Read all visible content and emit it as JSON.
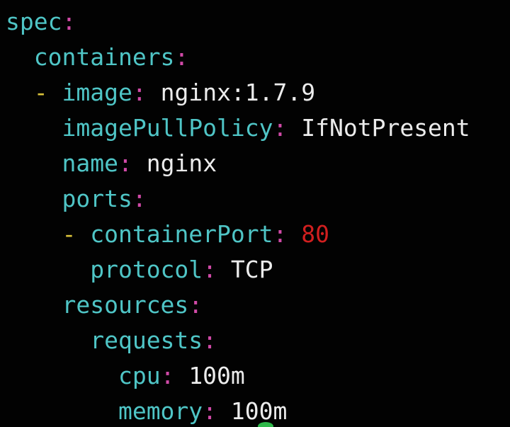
{
  "editor": {
    "lines": [
      {
        "indent": "",
        "dash": "",
        "key": "spec",
        "colon": ":",
        "value": "",
        "value_kind": "none"
      },
      {
        "indent": "  ",
        "dash": "",
        "key": "containers",
        "colon": ":",
        "value": "",
        "value_kind": "none"
      },
      {
        "indent": "  ",
        "dash": "- ",
        "key": "image",
        "colon": ":",
        "value": "nginx:1.7.9",
        "value_kind": "string"
      },
      {
        "indent": "    ",
        "dash": "",
        "key": "imagePullPolicy",
        "colon": ":",
        "value": "IfNotPresent",
        "value_kind": "string"
      },
      {
        "indent": "    ",
        "dash": "",
        "key": "name",
        "colon": ":",
        "value": "nginx",
        "value_kind": "string"
      },
      {
        "indent": "    ",
        "dash": "",
        "key": "ports",
        "colon": ":",
        "value": "",
        "value_kind": "none"
      },
      {
        "indent": "    ",
        "dash": "- ",
        "key": "containerPort",
        "colon": ":",
        "value": "80",
        "value_kind": "number"
      },
      {
        "indent": "      ",
        "dash": "",
        "key": "protocol",
        "colon": ":",
        "value": "TCP",
        "value_kind": "string"
      },
      {
        "indent": "    ",
        "dash": "",
        "key": "resources",
        "colon": ":",
        "value": "",
        "value_kind": "none"
      },
      {
        "indent": "      ",
        "dash": "",
        "key": "requests",
        "colon": ":",
        "value": "",
        "value_kind": "none"
      },
      {
        "indent": "        ",
        "dash": "",
        "key": "cpu",
        "colon": ":",
        "value": "100m",
        "value_kind": "string"
      },
      {
        "indent": "        ",
        "dash": "",
        "key": "memory",
        "colon": ":",
        "value": "100m",
        "value_kind": "string"
      }
    ]
  },
  "colors": {
    "background": "#020202",
    "key": "#4fc5c6",
    "colon": "#d14aa8",
    "dash": "#d9c23a",
    "value": "#ececec",
    "number": "#d11f1f",
    "cursor": "#2fb84a"
  }
}
